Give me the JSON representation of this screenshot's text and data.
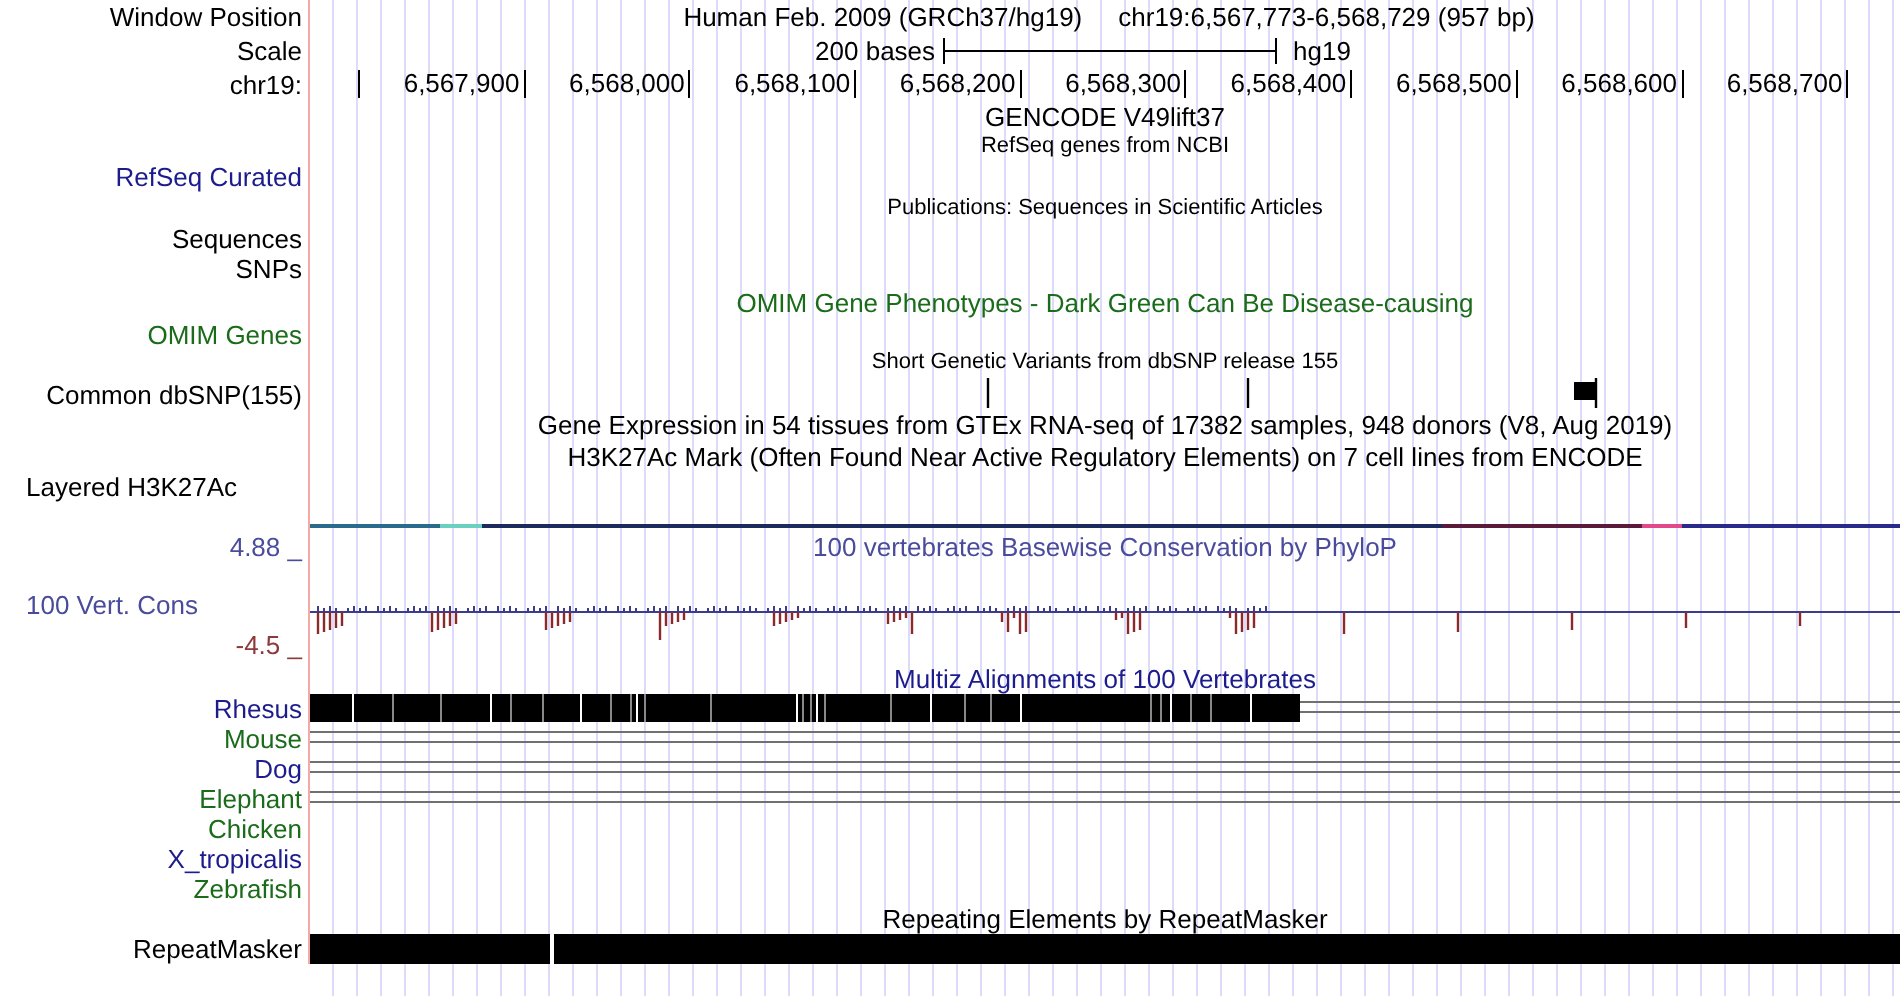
{
  "window_position": {
    "label": "Window Position",
    "assembly_name": "Human Feb. 2009 (GRCh37/hg19)",
    "range": "chr19:6,567,773-6,568,729 (957 bp)"
  },
  "scale": {
    "label": "Scale",
    "bar_label": "200 bases",
    "assembly": "hg19"
  },
  "ruler": {
    "label": "chr19:",
    "ticks": [
      "6,567,900",
      "6,568,000",
      "6,568,100",
      "6,568,200",
      "6,568,300",
      "6,568,400",
      "6,568,500",
      "6,568,600",
      "6,568,700"
    ]
  },
  "tracks": [
    {
      "kind": "title",
      "title": "GENCODE V49lift37"
    },
    {
      "kind": "genes",
      "title": "RefSeq genes from NCBI",
      "label": "RefSeq Curated"
    },
    {
      "kind": "publications",
      "title": "Publications: Sequences in Scientific Articles",
      "labels": [
        "Sequences",
        "SNPs"
      ]
    },
    {
      "kind": "omim",
      "title": "OMIM Gene Phenotypes - Dark Green Can Be Disease-causing",
      "label": "OMIM Genes"
    },
    {
      "kind": "snp",
      "title": "Short Genetic Variants from dbSNP release 155",
      "label": "Common dbSNP(155)"
    },
    {
      "kind": "title",
      "title": "Gene Expression in 54 tissues from GTEx RNA-seq of 17382 samples, 948 donors (V8, Aug 2019)"
    },
    {
      "kind": "layered",
      "title": "H3K27Ac Mark (Often Found Near Active Regulatory Elements) on 7 cell lines from ENCODE",
      "label": "Layered H3K27Ac"
    },
    {
      "kind": "wiggle",
      "title": "100 vertebrates Basewise Conservation by PhyloP",
      "label": "100 Vert. Cons",
      "max": "4.88 _",
      "min": "-4.5 _"
    },
    {
      "kind": "multiz",
      "title": "Multiz Alignments of 100 Vertebrates",
      "species": [
        {
          "name": "Rhesus",
          "color": "#1c1c8c",
          "kind": "bar"
        },
        {
          "name": "Mouse",
          "color": "#1a6b1a",
          "kind": "lines"
        },
        {
          "name": "Dog",
          "color": "#1c1c8c",
          "kind": "lines"
        },
        {
          "name": "Elephant",
          "color": "#1a6b1a",
          "kind": "lines"
        },
        {
          "name": "Chicken",
          "color": "#1a6b1a",
          "kind": "none"
        },
        {
          "name": "X_tropicalis",
          "color": "#1c1c8c",
          "kind": "none"
        },
        {
          "name": "Zebrafish",
          "color": "#1a6b1a",
          "kind": "none"
        }
      ]
    },
    {
      "kind": "repeats",
      "title": "Repeating Elements by RepeatMasker",
      "label": "RepeatMasker"
    }
  ]
}
